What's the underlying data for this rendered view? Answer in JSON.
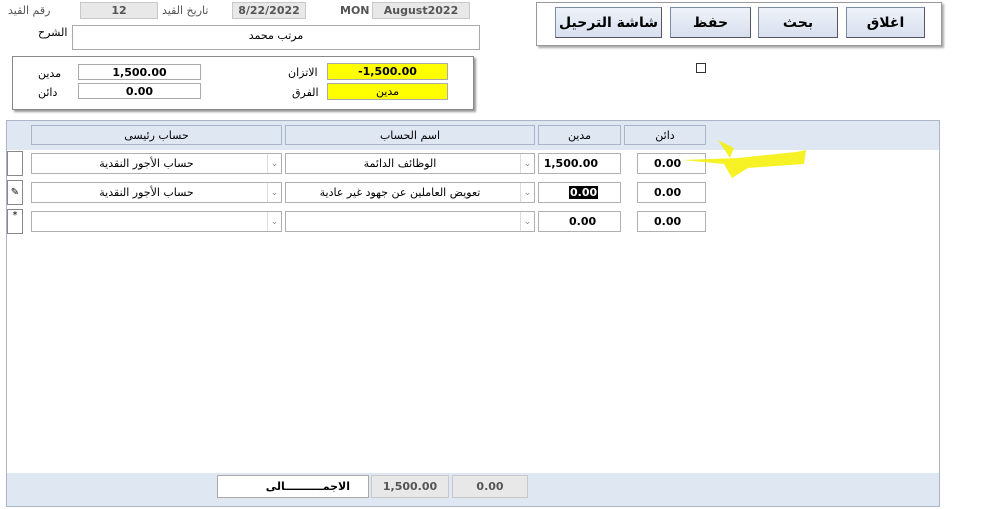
{
  "header": {
    "entry_no_label": "رقم القيد",
    "entry_no": "12",
    "entry_date_label": "تاريخ القيد",
    "entry_date": "8/22/2022",
    "day": "MON",
    "period": "August2022",
    "description_label": "الشرح",
    "description": "مرتب محمد"
  },
  "balance_panel": {
    "debit_label": "مدين",
    "debit": "1,500.00",
    "credit_label": "دائن",
    "credit": "0.00",
    "balance_label": "الاتزان",
    "balance": "-1,500.00",
    "difference_label": "الفرق",
    "difference": "مدين"
  },
  "toolbar": {
    "close_label": "اغلاق",
    "search_label": "بحث",
    "save_label": "حفظ",
    "posting_label": "شاشة الترحيل"
  },
  "table": {
    "columns": {
      "main_account": "حساب رئيسى",
      "account_name": "اسم الحساب",
      "debit": "مدين",
      "credit": "دائن"
    },
    "rows": [
      {
        "main_account": "حساب الأجور النقدية",
        "account_name": "الوظائف الدائمة",
        "debit": "1,500.00",
        "credit": "0.00",
        "selector": ""
      },
      {
        "main_account": "حساب الأجور النقدية",
        "account_name": "تعويض العاملين عن جهود غير عادية",
        "debit": "0.00",
        "credit": "0.00",
        "selector": "✎"
      },
      {
        "main_account": "",
        "account_name": "",
        "debit": "0.00",
        "credit": "0.00",
        "selector": "*"
      }
    ]
  },
  "footer": {
    "total_label": "الاجمــــــــــالى",
    "total_debit": "1,500.00",
    "total_credit": "0.00"
  },
  "colors": {
    "highlight": "#ffff00",
    "header_bg": "#dfe7f3",
    "annotation": "#f5f000"
  }
}
